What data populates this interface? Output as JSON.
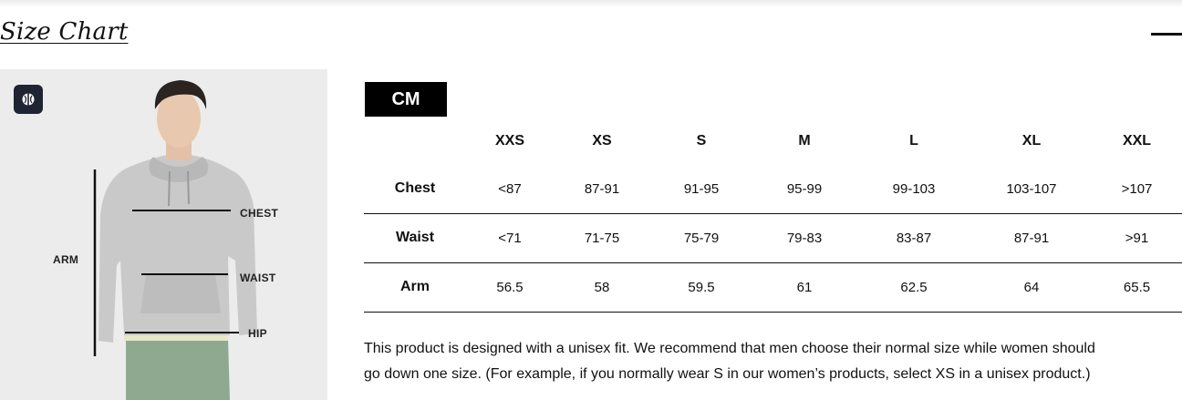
{
  "section": {
    "title": "Size Chart",
    "collapse_icon": "minus-icon"
  },
  "image": {
    "badge_icon": "brand-icon",
    "labels": {
      "arm": "ARM",
      "chest": "CHEST",
      "waist": "WAIST",
      "hip": "HIP"
    }
  },
  "unit_tab": {
    "label": "CM"
  },
  "table": {
    "columns": [
      "",
      "XXS",
      "XS",
      "S",
      "M",
      "L",
      "XL",
      "XXL"
    ],
    "rows": [
      {
        "label": "Chest",
        "values": [
          "<87",
          "87-91",
          "91-95",
          "95-99",
          "99-103",
          "103-107",
          ">107"
        ]
      },
      {
        "label": "Waist",
        "values": [
          "<71",
          "71-75",
          "75-79",
          "79-83",
          "83-87",
          "87-91",
          ">91"
        ]
      },
      {
        "label": "Arm",
        "values": [
          "56.5",
          "58",
          "59.5",
          "61",
          "62.5",
          "64",
          "65.5"
        ]
      }
    ]
  },
  "note": {
    "line1": "This product is designed with a unisex fit. We recommend that men choose their normal size while women should",
    "line2": "go down one size. (For example, if you normally wear S in our women’s products, select XS in a unisex product.)"
  },
  "colors": {
    "tab_bg": "#000000",
    "image_bg": "#ececec",
    "badge_bg": "#1f2433",
    "hoodie": "#c9c9c9",
    "pants": "#8fa990"
  }
}
